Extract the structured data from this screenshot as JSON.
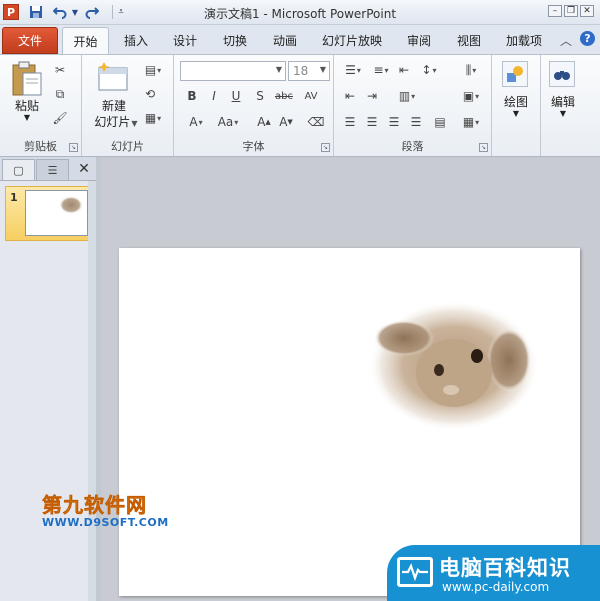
{
  "window": {
    "title": "演示文稿1 - Microsoft PowerPoint",
    "app_icon_letter": "P"
  },
  "quick_access": {
    "save_icon": "save-icon",
    "undo_icon": "undo-icon",
    "redo_icon": "redo-icon",
    "customize_icon": "customize-quick-access-icon"
  },
  "tabs": [
    {
      "label": "文件"
    },
    {
      "label": "开始"
    },
    {
      "label": "插入"
    },
    {
      "label": "设计"
    },
    {
      "label": "切换"
    },
    {
      "label": "动画"
    },
    {
      "label": "幻灯片放映"
    },
    {
      "label": "审阅"
    },
    {
      "label": "视图"
    },
    {
      "label": "加载项"
    }
  ],
  "ribbon": {
    "clipboard": {
      "paste": "粘贴",
      "group": "剪贴板"
    },
    "slides": {
      "new_slide_line1": "新建",
      "new_slide_line2": "幻灯片",
      "group": "幻灯片"
    },
    "font": {
      "font_name": "",
      "font_size": "18",
      "group": "字体"
    },
    "paragraph": {
      "group": "段落"
    },
    "drawing": {
      "label": "绘图"
    },
    "editing": {
      "label": "编辑"
    }
  },
  "thumbnails": {
    "slide_number": "1"
  },
  "watermarks": {
    "site1_title": "第九软件网",
    "site1_url": "WWW.D9SOFT.COM",
    "site2_title": "电脑百科知识",
    "site2_url": "www.pc-daily.com"
  },
  "colors": {
    "file_tab": "#d24726",
    "accent_blue": "#1891d3",
    "watermark_orange": "#f28c0e"
  }
}
